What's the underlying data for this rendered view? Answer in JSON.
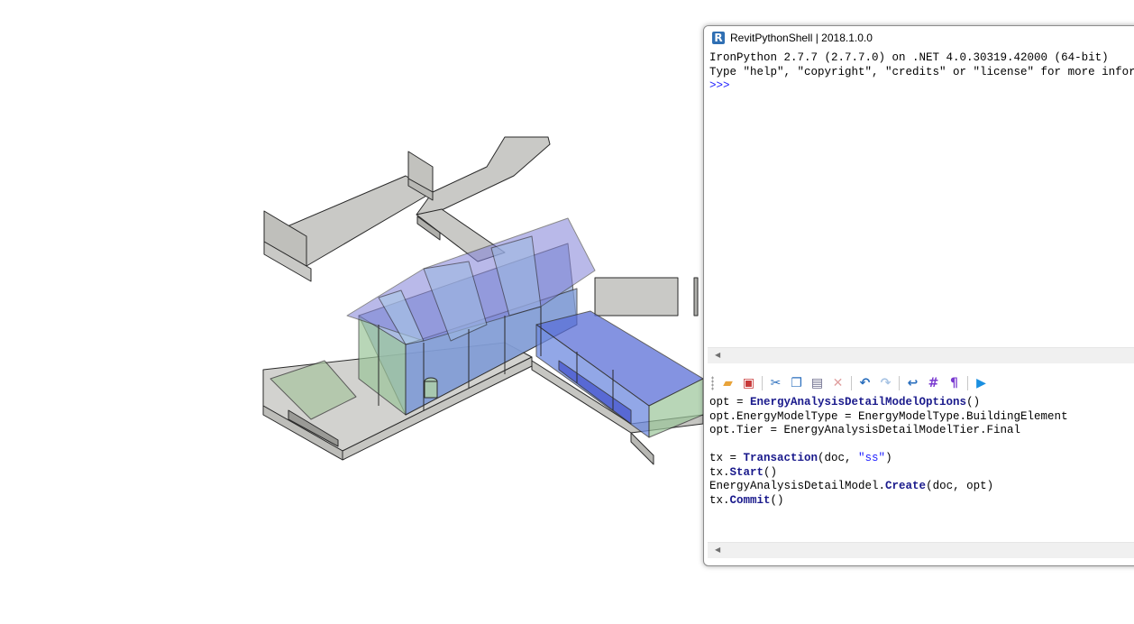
{
  "window": {
    "title": "RevitPythonShell | 2018.1.0.0",
    "icon_letter": "R"
  },
  "output": {
    "line1": "IronPython 2.7.7 (2.7.7.0) on .NET 4.0.30319.42000 (64-bit)",
    "line2": "Type \"help\", \"copyright\", \"credits\" or \"license\" for more information.",
    "prompt": ">>>"
  },
  "scroll_arrow": "◀",
  "toolbar": {
    "buttons": [
      {
        "name": "open-folder-icon",
        "glyph": "▰",
        "color": "#e8a33a"
      },
      {
        "name": "save-icon",
        "glyph": "▣",
        "color": "#c83a3a"
      },
      {
        "name": "cut-icon",
        "glyph": "✂",
        "color": "#2a6ebd"
      },
      {
        "name": "copy-icon",
        "glyph": "❐",
        "color": "#2a6ebd"
      },
      {
        "name": "paste-icon",
        "glyph": "▤",
        "color": "#6a6a8a"
      },
      {
        "name": "delete-icon",
        "glyph": "✕",
        "color": "#e0a0a0"
      },
      {
        "name": "undo-icon",
        "glyph": "↶",
        "color": "#2a6ebd"
      },
      {
        "name": "redo-icon",
        "glyph": "↷",
        "color": "#a8c4e4"
      },
      {
        "name": "word-wrap-icon",
        "glyph": "↩",
        "color": "#2a6ebd"
      },
      {
        "name": "line-numbers-icon",
        "glyph": "#",
        "color": "#7a3ad0"
      },
      {
        "name": "show-whitespace-icon",
        "glyph": "¶",
        "color": "#7a3ad0"
      },
      {
        "name": "run-icon",
        "glyph": "▶",
        "color": "#1a8fe0"
      }
    ]
  },
  "editor": {
    "l1a": "opt = ",
    "l1b": "EnergyAnalysisDetailModelOptions",
    "l1c": "()",
    "l2": "opt.EnergyModelType = EnergyModelType.BuildingElement",
    "l3": "opt.Tier = EnergyAnalysisDetailModelTier.Final",
    "l5a": "tx = ",
    "l5b": "Transaction",
    "l5c": "(doc, ",
    "l5d": "\"ss\"",
    "l5e": ")",
    "l6a": "tx.",
    "l6b": "Start",
    "l6c": "()",
    "l7a": "EnergyAnalysisDetailModel.",
    "l7b": "Create",
    "l7c": "(doc, opt)",
    "l8a": "tx.",
    "l8b": "Commit",
    "l8c": "()"
  }
}
